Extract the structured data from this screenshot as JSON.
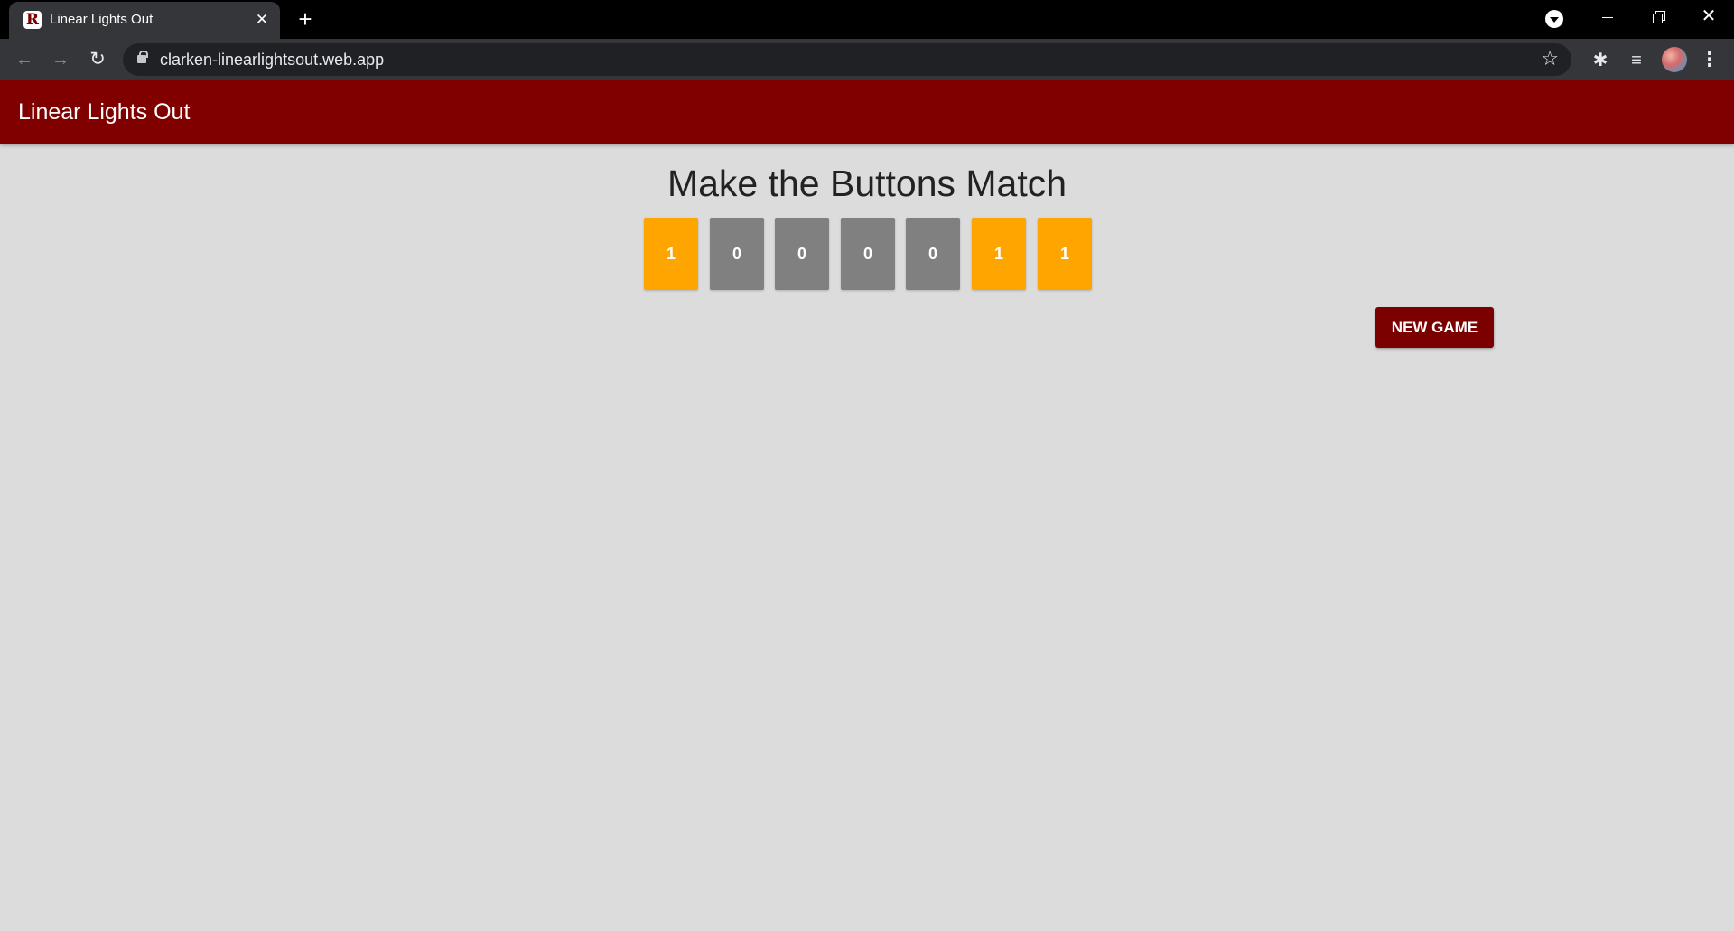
{
  "browser": {
    "tab": {
      "favicon_letter": "R",
      "title": "Linear Lights Out",
      "close_glyph": "✕"
    },
    "new_tab_glyph": "+",
    "url": "clarken-linearlightsout.web.app",
    "icons": {
      "back": "←",
      "forward": "→",
      "reload": "↻",
      "star": "☆",
      "extensions": "✱",
      "media": "≡",
      "menu": "⋮",
      "window_close": "✕"
    }
  },
  "app": {
    "title": "Linear Lights Out",
    "heading": "Make the Buttons Match",
    "lights": [
      {
        "value": "1",
        "on": true
      },
      {
        "value": "0",
        "on": false
      },
      {
        "value": "0",
        "on": false
      },
      {
        "value": "0",
        "on": false
      },
      {
        "value": "0",
        "on": false
      },
      {
        "value": "1",
        "on": true
      },
      {
        "value": "1",
        "on": true
      }
    ],
    "new_game_label": "NEW GAME",
    "colors": {
      "header": "#800000",
      "light_on": "#ffa500",
      "light_off": "#808080",
      "button": "#7b0000"
    }
  }
}
